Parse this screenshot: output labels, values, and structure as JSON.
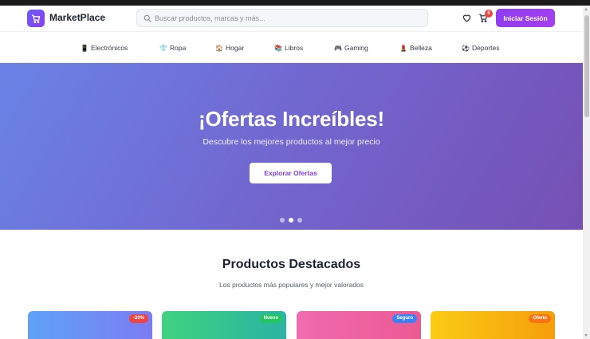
{
  "header": {
    "logo_text": "MarketPlace",
    "search_placeholder": "Buscar productos, marcas y más...",
    "cart_count": "0",
    "login_label": "Iniciar Sesión"
  },
  "nav": {
    "items": [
      {
        "label": "Electrónicos",
        "icon": "📱"
      },
      {
        "label": "Ropa",
        "icon": "👕"
      },
      {
        "label": "Hogar",
        "icon": "🏠"
      },
      {
        "label": "Libros",
        "icon": "📚"
      },
      {
        "label": "Gaming",
        "icon": "🎮"
      },
      {
        "label": "Belleza",
        "icon": "💄"
      },
      {
        "label": "Deportes",
        "icon": "⚽"
      }
    ]
  },
  "hero": {
    "title": "¡Ofertas Increíbles!",
    "subtitle": "Descubre los mejores productos al mejor precio",
    "button_label": "Explorar Ofertas",
    "active_slide": 2,
    "slide_count": 3
  },
  "featured": {
    "title": "Productos Destacados",
    "subtitle": "Los productos más populares y mejor valorados",
    "cards": [
      {
        "badge": "-20%",
        "badge_color": "#ef4444"
      },
      {
        "badge": "Nuevo",
        "badge_color": "#22c55e"
      },
      {
        "badge": "Seguro",
        "badge_color": "#3b82f6"
      },
      {
        "badge": "Oferta",
        "badge_color": "#f97316"
      }
    ]
  },
  "colors": {
    "accent": "#8d3cf2",
    "hero_start": "#6a83e6",
    "hero_end": "#7650b4"
  }
}
